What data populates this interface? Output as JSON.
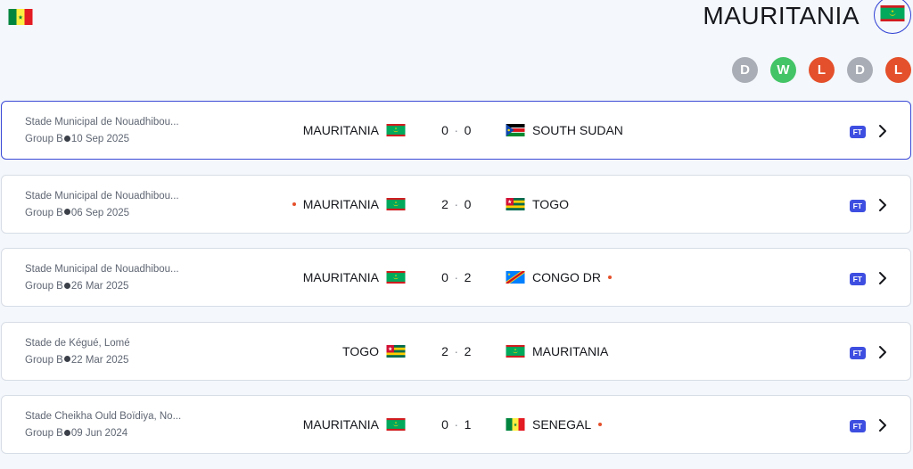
{
  "header": {
    "team_name": "MAURITANIA",
    "form": [
      {
        "label": "D",
        "color": "#a9adb5"
      },
      {
        "label": "W",
        "color": "#43c466"
      },
      {
        "label": "L",
        "color": "#e4502b"
      },
      {
        "label": "D",
        "color": "#a9adb5"
      },
      {
        "label": "L",
        "color": "#e4502b"
      }
    ]
  },
  "matches": [
    {
      "venue": "Stade Municipal de Nouadhibou...",
      "group": "Group B",
      "date": "10 Sep 2025",
      "home": "MAURITANIA",
      "home_flag": "mauritania",
      "home_score": "0",
      "away_score": "0",
      "away": "SOUTH SUDAN",
      "away_flag": "south-sudan",
      "status": "FT",
      "selected": true,
      "home_red_card": false,
      "away_red_card": false
    },
    {
      "venue": "Stade Municipal de Nouadhibou...",
      "group": "Group B",
      "date": "06 Sep 2025",
      "home": "MAURITANIA",
      "home_flag": "mauritania",
      "home_score": "2",
      "away_score": "0",
      "away": "TOGO",
      "away_flag": "togo",
      "status": "FT",
      "selected": false,
      "home_red_card": true,
      "away_red_card": false
    },
    {
      "venue": "Stade Municipal de Nouadhibou...",
      "group": "Group B",
      "date": "26 Mar 2025",
      "home": "MAURITANIA",
      "home_flag": "mauritania",
      "home_score": "0",
      "away_score": "2",
      "away": "CONGO DR",
      "away_flag": "congo-dr",
      "status": "FT",
      "selected": false,
      "home_red_card": false,
      "away_red_card": true
    },
    {
      "venue": "Stade de Kégué, Lomé",
      "group": "Group B",
      "date": "22 Mar 2025",
      "home": "TOGO",
      "home_flag": "togo",
      "home_score": "2",
      "away_score": "2",
      "away": "MAURITANIA",
      "away_flag": "mauritania",
      "status": "FT",
      "selected": false,
      "home_red_card": false,
      "away_red_card": false
    },
    {
      "venue": "Stade Cheikha Ould Boïdiya, No...",
      "group": "Group B",
      "date": "09 Jun 2024",
      "home": "MAURITANIA",
      "home_flag": "mauritania",
      "home_score": "0",
      "away_score": "1",
      "away": "SENEGAL",
      "away_flag": "senegal",
      "status": "FT",
      "selected": false,
      "home_red_card": false,
      "away_red_card": true
    }
  ]
}
